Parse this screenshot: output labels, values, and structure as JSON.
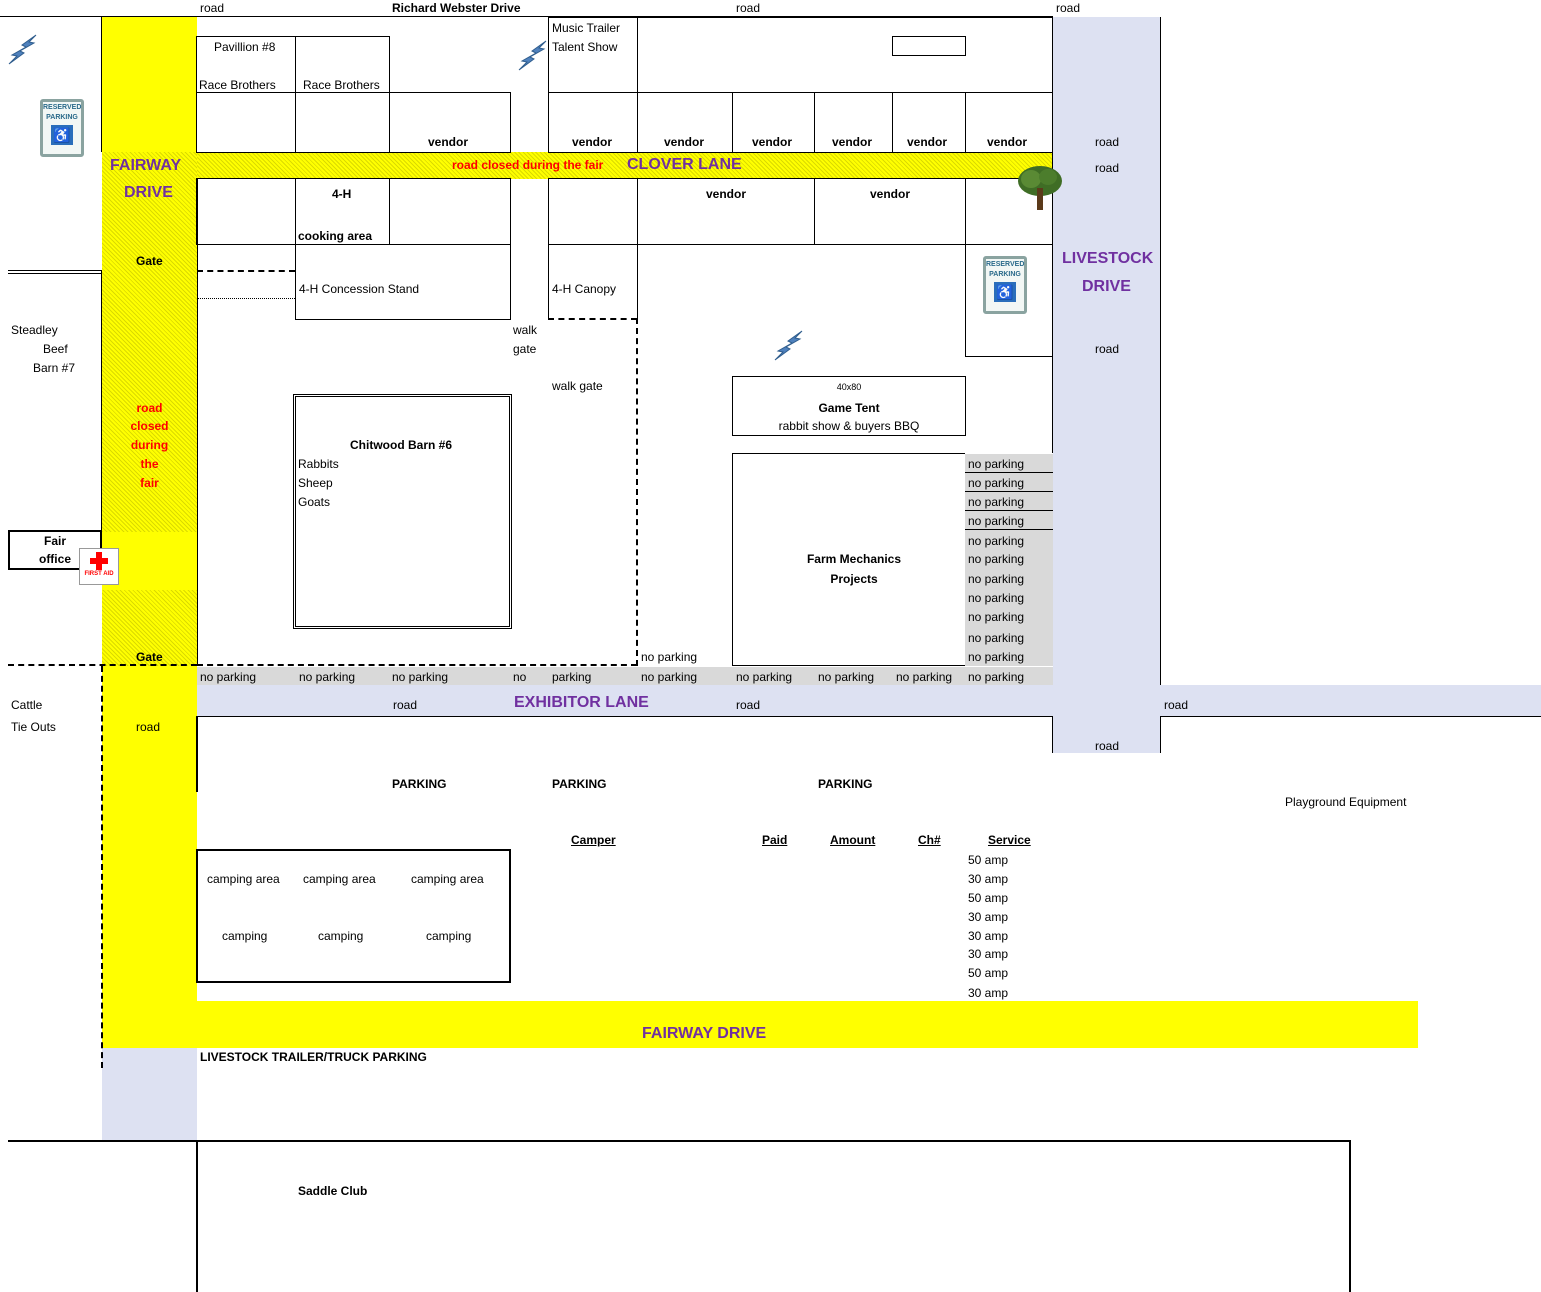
{
  "top": {
    "road_left": "road",
    "street": "Richard Webster Drive",
    "road_mid": "road",
    "road_right": "road"
  },
  "buildings": {
    "pavillion": "Pavillion #8",
    "race1": "Race Brothers",
    "race2": "Race Brothers",
    "music_line1": "Music Trailer",
    "music_line2": "Talent Show",
    "vendor": "vendor",
    "fourh": "4-H",
    "cooking": "cooking area",
    "concession": "4-H Concession Stand",
    "canopy": "4-H Canopy",
    "walk1": "walk",
    "walk2": "gate",
    "walkgate": "walk gate",
    "tent_size": "40x80",
    "tent_name": "Game Tent",
    "tent_sub": "rabbit show & buyers BBQ",
    "chitwood": "Chitwood Barn #6",
    "rabbits": "Rabbits",
    "sheep": "Sheep",
    "goats": "Goats",
    "farm1": "Farm Mechanics",
    "farm2": "Projects",
    "saddle": "Saddle Club",
    "playground": "Playground Equipment"
  },
  "roads": {
    "clover": "CLOVER LANE",
    "clover_closed": "road closed during the fair",
    "fairway1": "FAIRWAY",
    "fairway2": "DRIVE",
    "fairway_bottom": "FAIRWAY DRIVE",
    "livestock1": "LIVESTOCK",
    "livestock2": "DRIVE",
    "exhibitor": "EXHIBITOR LANE",
    "road": "road",
    "gate": "Gate",
    "closed": [
      "road",
      "closed",
      "during",
      "the",
      "fair"
    ]
  },
  "left": {
    "steadley": [
      "Steadley",
      "Beef",
      "Barn #7"
    ],
    "fair": [
      "Fair",
      "office"
    ],
    "first_aid": "FIRST AID",
    "cattle": [
      "Cattle",
      "Tie Outs"
    ]
  },
  "parking": {
    "no_parking": "no parking",
    "no": "no",
    "parking_label": "PARKING",
    "reserved": [
      "RESERVED",
      "PARKING"
    ],
    "trailer": "LIVESTOCK TRAILER/TRUCK PARKING"
  },
  "camping": {
    "area": "camping area",
    "camp": "camping",
    "headers": [
      "Camper",
      "Paid",
      "Amount",
      "Ch#",
      "Service"
    ],
    "services": [
      "50 amp",
      "30 amp",
      "50 amp",
      "30 amp",
      "30 amp",
      "30 amp",
      "50 amp",
      "30 amp"
    ]
  },
  "icons": [
    "lightning-icon",
    "reserved-parking-sign-icon",
    "tree-icon",
    "first-aid-icon"
  ],
  "colors": {
    "road_yellow": "#ffff00",
    "road_blue": "#dde1f2",
    "label_purple": "#7030a0",
    "closed_red": "#ff0000",
    "no_parking_gray": "#d9d9d9"
  }
}
